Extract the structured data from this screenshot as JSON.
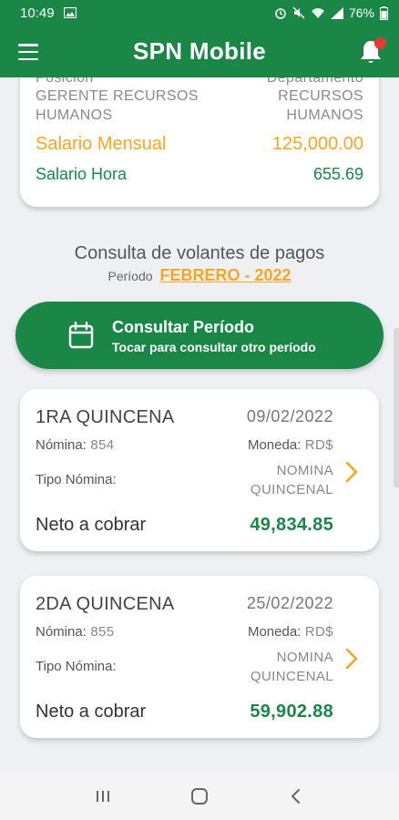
{
  "status_bar": {
    "time": "10:49",
    "battery": "76%"
  },
  "app_bar": {
    "title": "SPN Mobile"
  },
  "employee": {
    "position_label": "Posición",
    "department_label": "Departamento",
    "position_line1": "GERENTE RECURSOS",
    "position_line2": "HUMANOS",
    "department_line1": "RECURSOS",
    "department_line2": "HUMANOS",
    "monthly_salary_label": "Salario Mensual",
    "monthly_salary_value": "125,000.00",
    "hourly_salary_label": "Salario Hora",
    "hourly_salary_value": "655.69"
  },
  "consulta": {
    "title": "Consulta de volantes de pagos",
    "period_label": "Período",
    "period_value": "FEBRERO - 2022"
  },
  "consult_button": {
    "title": "Consultar Período",
    "subtitle": "Tocar para consultar otro período"
  },
  "payslips": [
    {
      "quincena": "1RA QUINCENA",
      "date": "09/02/2022",
      "nomina_label": "Nómina:",
      "nomina_value": "854",
      "moneda_label": "Moneda:",
      "moneda_value": "RD$",
      "tipo_label": "Tipo Nómina:",
      "tipo_line1": "NOMINA",
      "tipo_line2": "QUINCENAL",
      "neto_label": "Neto a cobrar",
      "neto_value": "49,834.85"
    },
    {
      "quincena": "2DA QUINCENA",
      "date": "25/02/2022",
      "nomina_label": "Nómina:",
      "nomina_value": "855",
      "moneda_label": "Moneda:",
      "moneda_value": "RD$",
      "tipo_label": "Tipo Nómina:",
      "tipo_line1": "NOMINA",
      "tipo_line2": "QUINCENAL",
      "neto_label": "Neto a cobrar",
      "neto_value": "59,902.88"
    }
  ],
  "colors": {
    "primary_green": "#1a8747",
    "accent_orange": "#f5a623",
    "notification_red": "#e53935"
  },
  "icons": {
    "menu": "hamburger-icon",
    "notifications": "bell-icon",
    "calendar": "calendar-icon",
    "chevron": "chevron-right-icon"
  }
}
